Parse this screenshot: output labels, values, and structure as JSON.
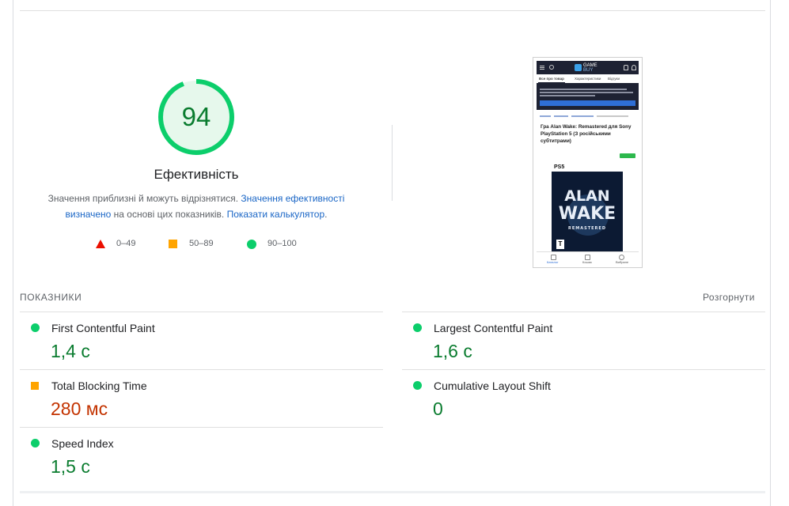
{
  "gauge": {
    "score": "94",
    "value": 94,
    "title": "Ефективність",
    "color": "#0cce6b"
  },
  "description": {
    "text1": "Значення приблизні й можуть відрізнятися. ",
    "link1": "Значення ефективності визначено",
    "text2": " на основі цих показників. ",
    "link2": "Показати калькулятор",
    "text3": "."
  },
  "legend": [
    {
      "icon": "red-triangle-icon",
      "label": "0–49",
      "color": "#eb0f00"
    },
    {
      "icon": "orange-square-icon",
      "label": "50–89",
      "color": "#ffa400"
    },
    {
      "icon": "green-circle-icon",
      "label": "90–100",
      "color": "#0cce6b"
    }
  ],
  "screenshot": {
    "logo_top": "GAME",
    "logo_bottom": "BUY",
    "tabs": [
      "Все про товар",
      "Характеристики",
      "Відгуки"
    ],
    "product_title": "Гра Alan Wake: Remastered для Sony PlayStation 5 (З російськими субтитрами)",
    "cover_platform": "PS5",
    "cover_title_1": "ALAN",
    "cover_title_2": "WAKE",
    "cover_subtitle": "REMASTERED",
    "cover_rating": "T",
    "nav": [
      "Каталог",
      "Кошик",
      "Вибране"
    ]
  },
  "metrics": {
    "section_label": "ПОКАЗНИКИ",
    "expand_label": "Розгорнути",
    "items": [
      {
        "name": "First Contentful Paint",
        "value": "1,4 с",
        "status": "good"
      },
      {
        "name": "Largest Contentful Paint",
        "value": "1,6 с",
        "status": "good"
      },
      {
        "name": "Total Blocking Time",
        "value": "280 мс",
        "status": "average"
      },
      {
        "name": "Cumulative Layout Shift",
        "value": "0",
        "status": "good"
      },
      {
        "name": "Speed Index",
        "value": "1,5 с",
        "status": "good"
      }
    ]
  },
  "colors": {
    "good": "#0cce6b",
    "good_text": "#0a7c2f",
    "average": "#ffa400",
    "average_text": "#c33300",
    "poor": "#eb0f00",
    "link": "#1a66c6"
  }
}
